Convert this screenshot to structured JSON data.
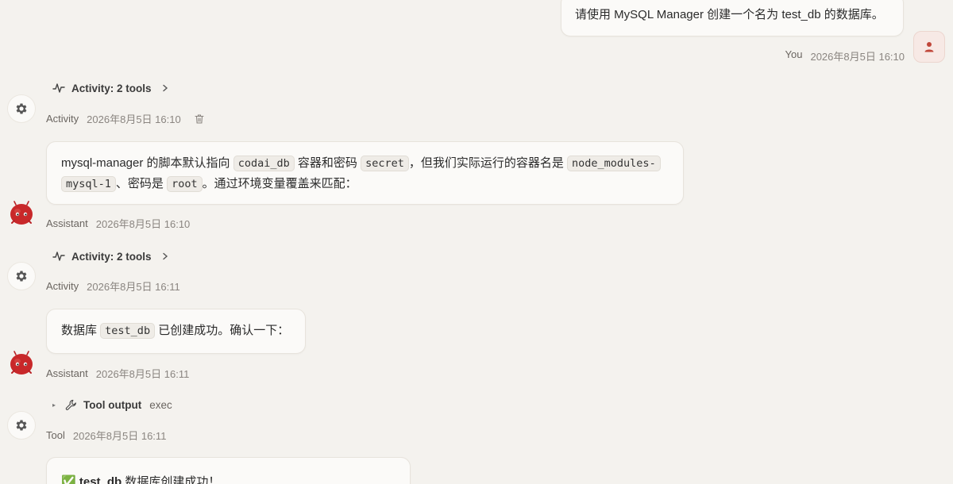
{
  "user_message": {
    "text": "请使用 MySQL Manager 创建一个名为 test_db 的数据库。",
    "author": "You",
    "timestamp": "2026年8月5日 16:10"
  },
  "activity_1": {
    "label": "Activity: 2 tools",
    "author": "Activity",
    "timestamp": "2026年8月5日 16:10"
  },
  "assistant_1": {
    "t1": "mysql-manager 的脚本默认指向 ",
    "c1": "codai_db",
    "t2": " 容器和密码 ",
    "c2": "secret",
    "t3": "，但我们实际运行的容器名是 ",
    "c3a": "node_modules-",
    "c3b": "mysql-1",
    "t4": "、密码是 ",
    "c4": "root",
    "t5": "。通过环境变量覆盖来匹配：",
    "author": "Assistant",
    "timestamp": "2026年8月5日 16:10"
  },
  "activity_2": {
    "label": "Activity: 2 tools",
    "author": "Activity",
    "timestamp": "2026年8月5日 16:11"
  },
  "assistant_2": {
    "t1": "数据库 ",
    "c1": "test_db",
    "t2": " 已创建成功。确认一下：",
    "author": "Assistant",
    "timestamp": "2026年8月5日 16:11"
  },
  "tool_1": {
    "label": "Tool output",
    "command": "exec",
    "author": "Tool",
    "timestamp": "2026年8月5日 16:11",
    "result_check": "✅",
    "result_bold": "test_db",
    "result_text": " 数据库创建成功！"
  },
  "icons": {
    "user": "user-icon",
    "gear": "gear-icon",
    "activity": "activity-pulse-icon",
    "chevron": "chevron-right-icon",
    "trash": "trash-icon",
    "wrench": "wrench-icon",
    "assistant": "red-mascot-icon"
  },
  "colors": {
    "background": "#f4f2ee",
    "bubble": "#fbfaf8",
    "muted_text": "#8a8580",
    "mascot_red": "#c8282a"
  }
}
